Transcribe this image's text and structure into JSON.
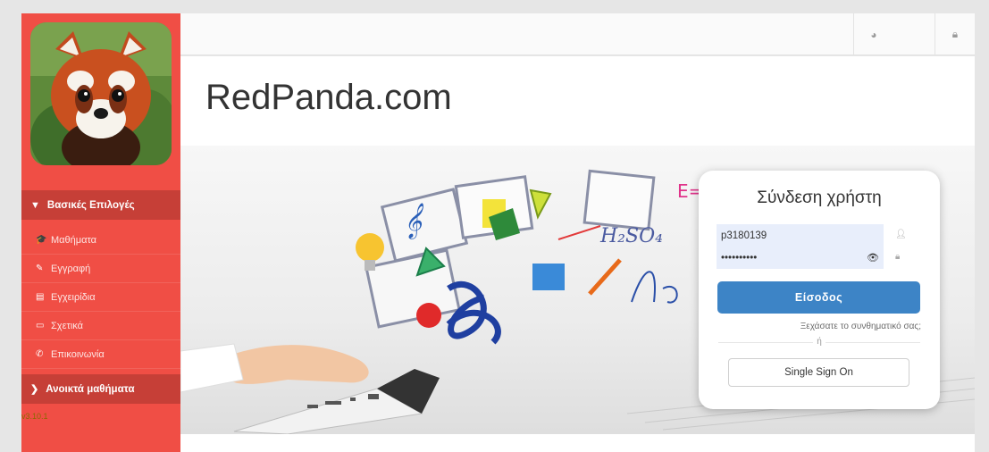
{
  "sidebar": {
    "section_main": "Βασικές Επιλογές",
    "items": [
      {
        "label": "Μαθήματα",
        "icon": "graduation-cap-icon"
      },
      {
        "label": "Εγγραφή",
        "icon": "edit-icon"
      },
      {
        "label": "Εγχειρίδια",
        "icon": "file-icon"
      },
      {
        "label": "Σχετικά",
        "icon": "card-icon"
      },
      {
        "label": "Επικοινωνία",
        "icon": "phone-icon"
      }
    ],
    "section_open": "Ανοικτά μαθήματα",
    "version": "v3.10.1"
  },
  "header": {
    "site_title": "RedPanda.com"
  },
  "login": {
    "title": "Σύνδεση χρήστη",
    "username": "p3180139",
    "password": "••••••••••",
    "submit": "Είσοδος",
    "forgot": "Ξεχάσατε το συνθηματικό σας;",
    "or": "ή",
    "sso": "Single Sign On"
  },
  "colors": {
    "sidebar": "#f04e45",
    "sidebar_header": "#c63f37",
    "primary_button": "#3d84c6"
  }
}
